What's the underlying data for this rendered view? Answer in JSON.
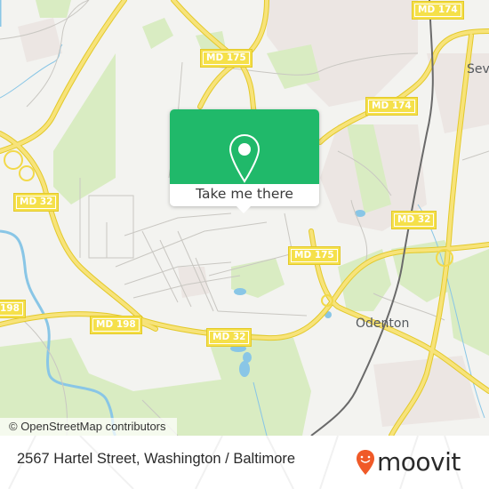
{
  "map": {
    "road_shields": [
      {
        "id": "md174-top",
        "label": "MD 174"
      },
      {
        "id": "md175-top",
        "label": "MD 175"
      },
      {
        "id": "md174-mid",
        "label": "MD 174"
      },
      {
        "id": "md32-west",
        "label": "MD 32"
      },
      {
        "id": "md32-east",
        "label": "MD 32"
      },
      {
        "id": "md175-east",
        "label": "MD 175"
      },
      {
        "id": "md198-west",
        "label": "198"
      },
      {
        "id": "md198-mid",
        "label": "MD 198"
      },
      {
        "id": "md32-south",
        "label": "MD 32"
      }
    ],
    "places": [
      {
        "id": "odenton",
        "label": "Odenton"
      },
      {
        "id": "severn",
        "label": "Seve"
      }
    ],
    "colors": {
      "land": "#f3f3f0",
      "park": "#d9ecc2",
      "water": "#89c6e6",
      "highway": "#f5e04a",
      "urban": "#ece6e3",
      "rail": "#666666"
    }
  },
  "popup": {
    "icon": "map-pin-icon",
    "button_label": "Take me there",
    "color": "#20b96a"
  },
  "attribution": "© OpenStreetMap contributors",
  "footer": {
    "address": "2567 Hartel Street, Washington / Baltimore",
    "logo_text": "moovit",
    "logo_icon": "moovit-pin-icon",
    "logo_color": "#f05a28"
  }
}
